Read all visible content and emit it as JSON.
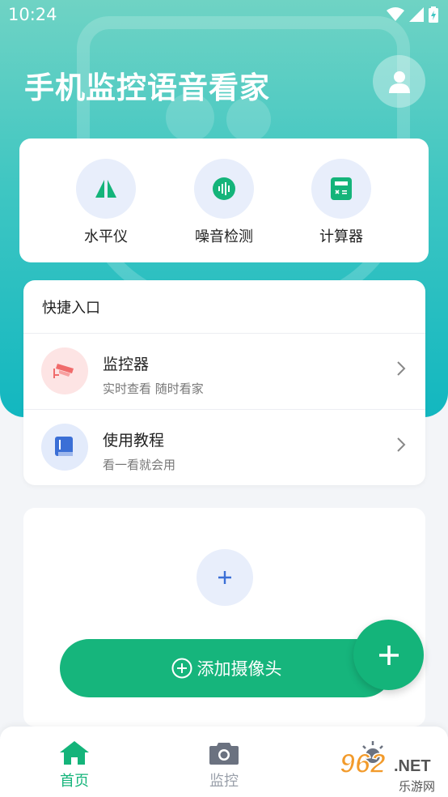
{
  "status_bar": {
    "time": "10:24"
  },
  "header": {
    "title": "手机监控语音看家"
  },
  "tools": [
    {
      "label": "水平仪",
      "icon": "level-icon"
    },
    {
      "label": "噪音检测",
      "icon": "sound-wave-icon"
    },
    {
      "label": "计算器",
      "icon": "calculator-icon"
    }
  ],
  "quick": {
    "title": "快捷入口",
    "items": [
      {
        "title": "监控器",
        "subtitle": "实时查看 随时看家",
        "icon": "camera-monitor-icon",
        "color": "#f06b6b"
      },
      {
        "title": "使用教程",
        "subtitle": "看一看就会用",
        "icon": "book-icon",
        "color": "#3b6fd6"
      }
    ]
  },
  "add_camera": {
    "label": "添加摄像头"
  },
  "nav": [
    {
      "label": "首页",
      "icon": "home-icon",
      "active": true
    },
    {
      "label": "监控",
      "icon": "camera-icon",
      "active": false
    }
  ],
  "watermark": {
    "brand": "962.NET",
    "sub": "乐游网"
  },
  "colors": {
    "accent": "#16b57c",
    "hero_top": "#6fd3c4",
    "hero_bottom": "#12b7c0",
    "icon_bg": "#e8eefb"
  }
}
